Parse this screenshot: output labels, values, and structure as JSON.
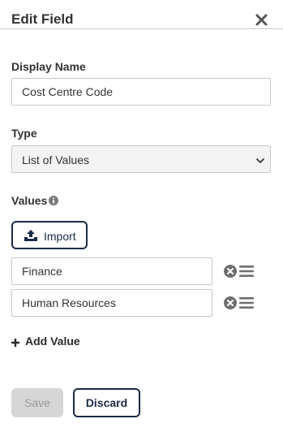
{
  "header": {
    "title": "Edit Field",
    "close_icon": "close-icon"
  },
  "display_name": {
    "label": "Display Name",
    "value": "Cost Centre Code"
  },
  "type": {
    "label": "Type",
    "selected": "List of Values",
    "chevron_icon": "chevron-down-icon"
  },
  "values": {
    "label": "Values",
    "info_icon": "info-icon",
    "import_button": {
      "label": "Import",
      "icon": "upload-icon"
    },
    "items": [
      {
        "value": "Finance",
        "remove_icon": "remove-icon",
        "drag_icon": "drag-handle-icon"
      },
      {
        "value": "Human Resources",
        "remove_icon": "remove-icon",
        "drag_icon": "drag-handle-icon"
      }
    ],
    "add_value": {
      "label": "Add Value",
      "icon": "plus-icon"
    }
  },
  "footer": {
    "save_label": "Save",
    "save_disabled": true,
    "discard_label": "Discard"
  },
  "colors": {
    "primary_navy": "#1b2a47",
    "disabled_bg": "#d6d6d6",
    "disabled_text": "#9a9a9a",
    "border": "#c8c8c8",
    "select_bg": "#f3f3f3",
    "icon_grey": "#6f6f6f"
  }
}
